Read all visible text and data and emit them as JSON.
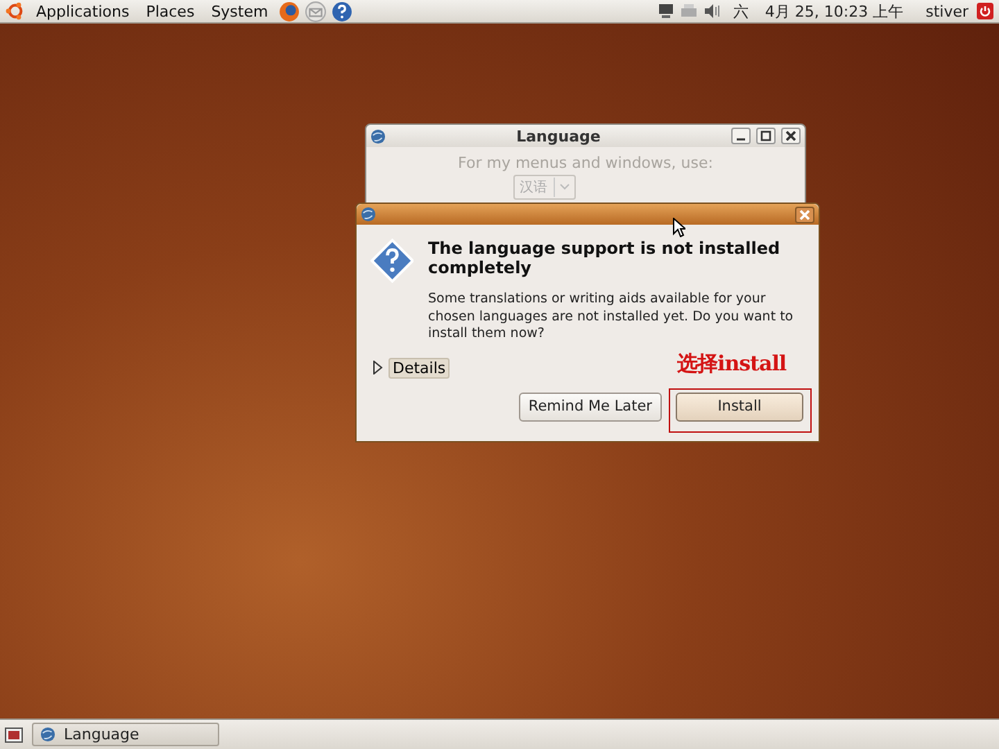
{
  "top_panel": {
    "menus": [
      "Applications",
      "Places",
      "System"
    ],
    "weekday": "六",
    "datetime": "4月 25, 10:23 上午",
    "user": "stiver"
  },
  "language_window": {
    "title": "Language",
    "prompt": "For my menus and windows, use:",
    "language_value": "汉语"
  },
  "dialog": {
    "heading": "The language support is not installed completely",
    "message": "Some translations or writing aids available for your chosen languages are not installed yet. Do you want to install them now?",
    "details": {
      "label": "Details",
      "expanded": false
    },
    "buttons": [
      {
        "label": "Remind Me Later",
        "default": false
      },
      {
        "label": "Install",
        "default": true
      }
    ]
  },
  "annotation": {
    "text": "选择install"
  },
  "taskbar": {
    "items": [
      {
        "label": "Language"
      }
    ]
  }
}
